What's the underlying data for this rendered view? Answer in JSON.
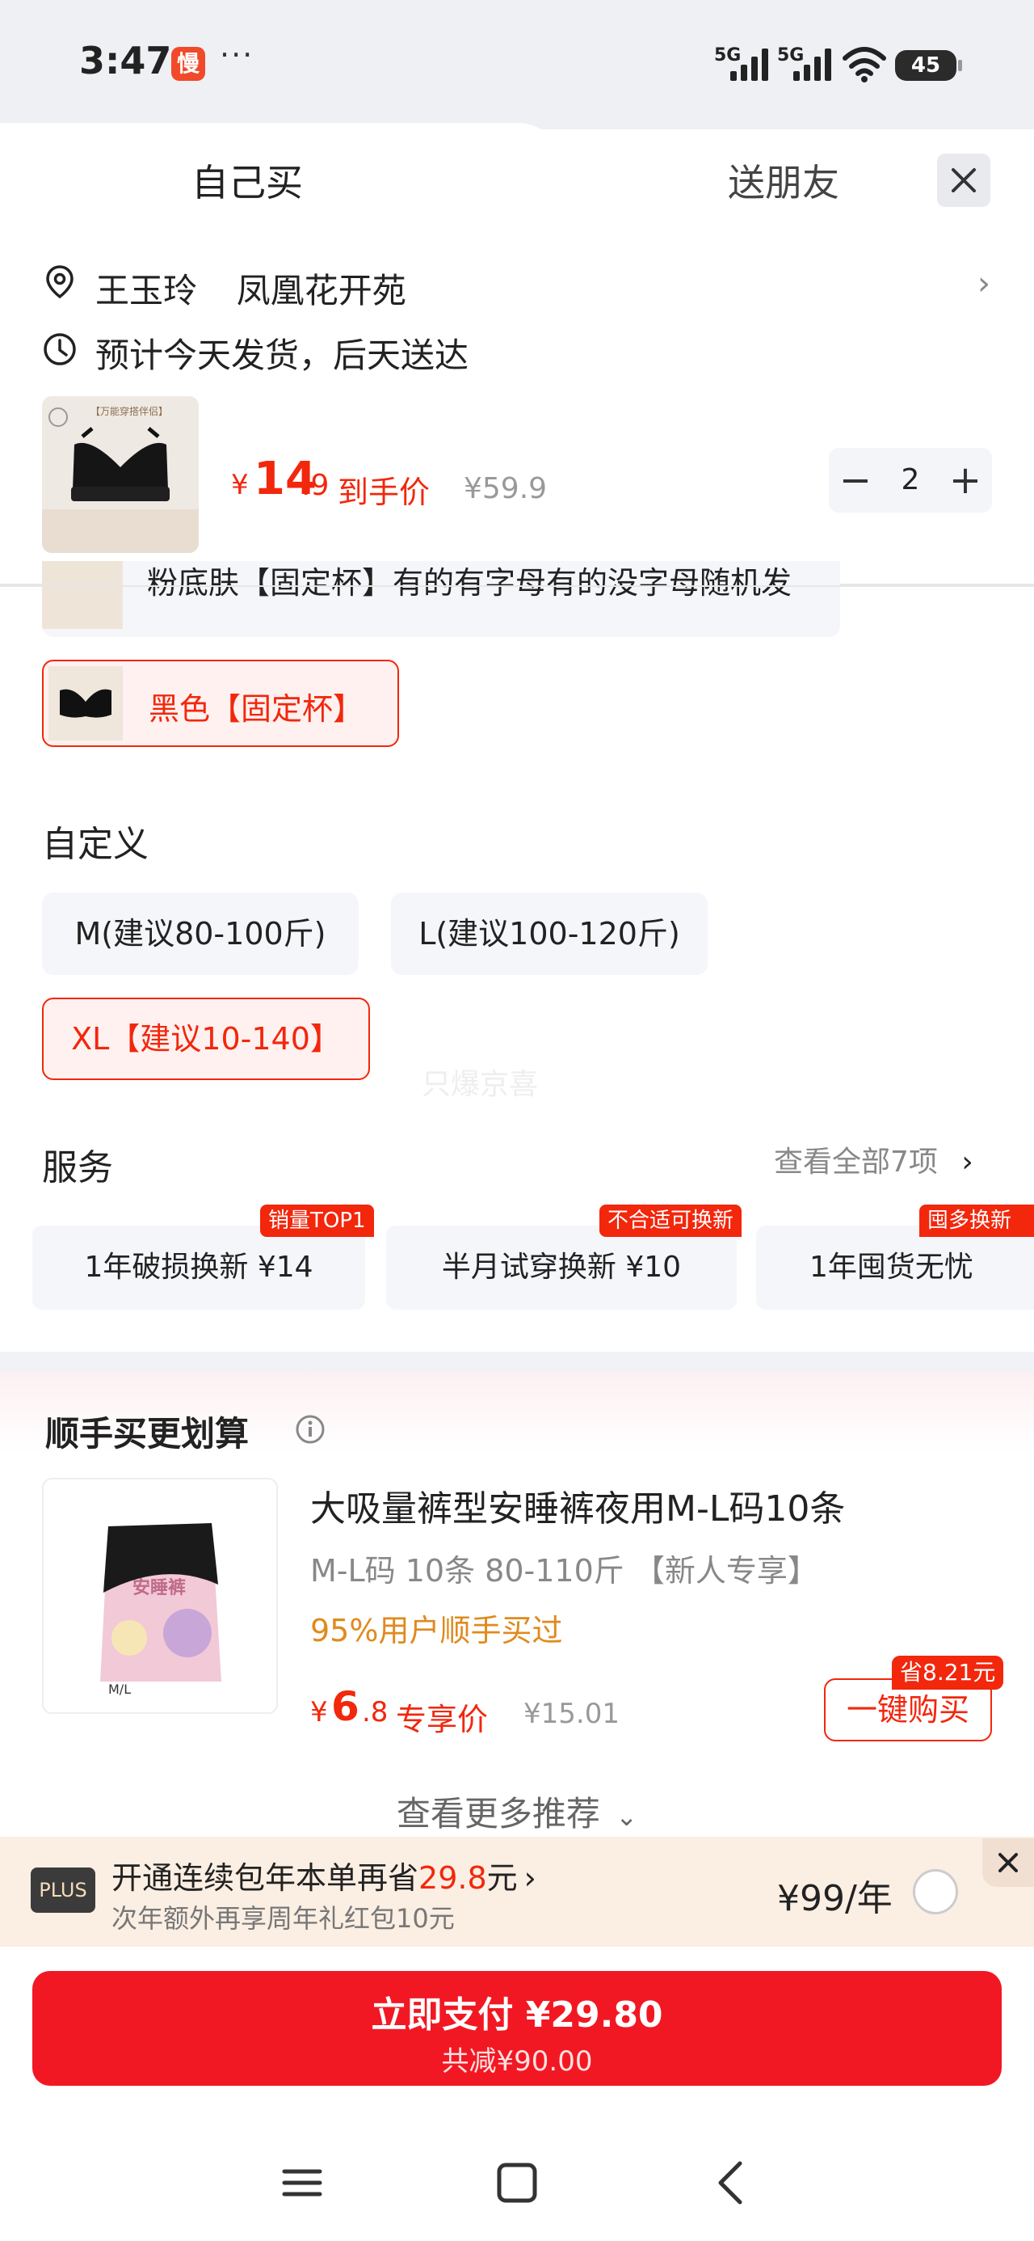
{
  "status_bar": {
    "time": "3:47",
    "slow_badge": "慢",
    "dots": "···",
    "net1": "5G",
    "net2": "5G",
    "battery": "45"
  },
  "tabs": {
    "self": "自己买",
    "gift": "送朋友"
  },
  "address": {
    "name": "王玉玲",
    "place": "凤凰花开苑"
  },
  "shipping": "预计今天发货，后天送达",
  "product": {
    "currency": "¥",
    "price_int": "14",
    "price_dec": ".9",
    "price_tag": "到手价",
    "orig_price": "¥59.9",
    "qty": "2",
    "img_label": "【万能穿搭伴侣】"
  },
  "color_options": {
    "partial_text": "粉底肤【固定杯】有的有字母有的没字母随机发",
    "selected_label": "黑色【固定杯】"
  },
  "custom": {
    "title": "自定义",
    "options": [
      "M(建议80-100斤)",
      "L(建议100-120斤)",
      "XL【建议10-140】"
    ],
    "selected_index": 2,
    "watermark": "只爆京喜"
  },
  "service": {
    "title": "服务",
    "view_all": "查看全部7项",
    "items": [
      {
        "label": "1年破损换新  ¥14",
        "badge": "销量TOP1"
      },
      {
        "label": "半月试穿换新  ¥10",
        "badge": "不合适可换新"
      },
      {
        "label": "1年囤货无忧",
        "badge": "囤多换新"
      }
    ]
  },
  "recommend": {
    "title": "顺手买更划算",
    "item_title": "大吸量裤型安睡裤夜用M-L码10条",
    "item_sub": "M-L码 10条 80-110斤 【新人专享】",
    "item_pct": "95%用户顺手买过",
    "currency": "¥",
    "price_int": "6",
    "price_dec": ".8",
    "price_tag": "专享价",
    "orig_price": "¥15.01",
    "save_badge": "省8.21元",
    "buy_label": "一键购买",
    "img_text": "安睡裤",
    "img_size": "M/L",
    "more": "查看更多推荐"
  },
  "plus": {
    "logo": "PLUS",
    "line1_a": "开通连续包年本单再省",
    "line1_amt": "29.8",
    "line1_b": "元",
    "line2": "次年额外再享周年礼红包10元",
    "price": "¥99/年"
  },
  "pay": {
    "main": "立即支付 ¥29.80",
    "sub": "共减¥90.00"
  },
  "colors": {
    "accent": "#f2270c",
    "pay": "#f21823",
    "plus_bg": "#fbeee3"
  }
}
